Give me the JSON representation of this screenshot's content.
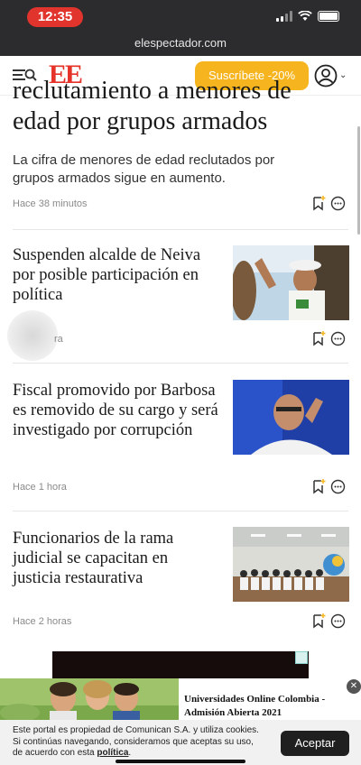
{
  "status": {
    "time": "12:35",
    "url": "elespectador.com"
  },
  "header": {
    "logo_text": "EE",
    "subscribe_label": "Suscríbete -20%",
    "brand_color": "#e5332a",
    "subscribe_color": "#f6b41e"
  },
  "top_story": {
    "title_cut": "reclutamiento a menores de",
    "title_line2": "edad por grupos armados",
    "lead": "La cifra de menores de edad reclutados por grupos armados sigue en aumento.",
    "time": "Hace 38 minutos"
  },
  "stories": [
    {
      "title": "Suspenden alcalde de Neiva por posible participación en política",
      "time": "ra"
    },
    {
      "title": "Fiscal promovido por Barbosa es removido de su cargo y será investigado por corrupción",
      "time": "Hace 1 hora"
    },
    {
      "title": "Funcionarios de la rama judicial se capacitan en justicia restaurativa",
      "time": "Hace 2 horas"
    }
  ],
  "icons": {
    "menu": "menu-search-icon",
    "user": "user-icon",
    "bookmark": "bookmark-add-icon",
    "comment": "comment-icon"
  },
  "ad": {
    "text": "Universidades Online Colombia - Admisión Abierta 2021",
    "close": "✕"
  },
  "cookie": {
    "text": "Este portal es propiedad de Comunican S.A. y utiliza cookies. Si continúas navegando, consideramos que aceptas su uso, de acuerdo con esta",
    "link": "política",
    "accept_label": "Aceptar"
  }
}
